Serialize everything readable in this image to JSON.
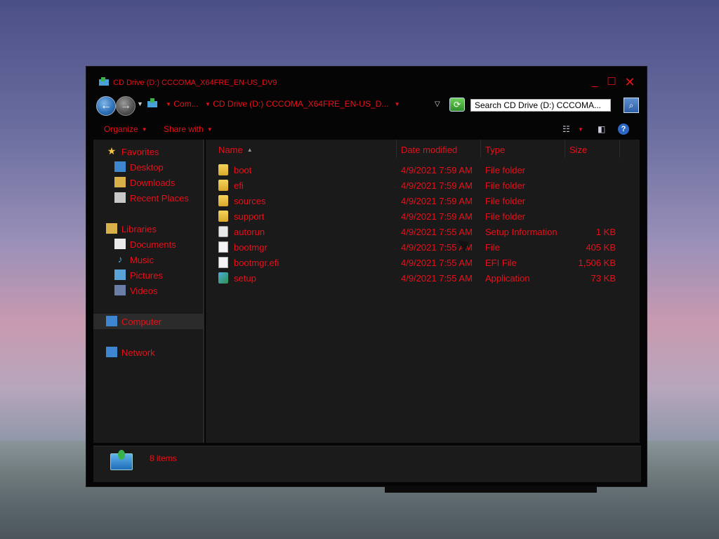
{
  "window": {
    "title": "CD Drive (D:) CCCOMA_X64FRE_EN-US_DV9",
    "controls": {
      "minimize": "_",
      "maximize": "☐",
      "close": "✕"
    }
  },
  "nav": {
    "breadcrumbs": [
      "Com...",
      "CD Drive (D:) CCCOMA_X64FRE_EN-US_D..."
    ],
    "search_placeholder": "Search CD Drive (D:) CCCOMA..."
  },
  "toolbar": {
    "organize": "Organize",
    "share_with": "Share with"
  },
  "sidebar": {
    "favorites": "Favorites",
    "fav_items": [
      "Desktop",
      "Downloads",
      "Recent Places"
    ],
    "libraries": "Libraries",
    "lib_items": [
      "Documents",
      "Music",
      "Pictures",
      "Videos"
    ],
    "computer": "Computer",
    "network": "Network"
  },
  "columns": {
    "name": "Name",
    "date": "Date modified",
    "type": "Type",
    "size": "Size"
  },
  "files": [
    {
      "name": "boot",
      "date": "4/9/2021 7:59 AM",
      "type": "File folder",
      "size": "",
      "icon": "folder-icon"
    },
    {
      "name": "efi",
      "date": "4/9/2021 7:59 AM",
      "type": "File folder",
      "size": "",
      "icon": "folder-icon"
    },
    {
      "name": "sources",
      "date": "4/9/2021 7:59 AM",
      "type": "File folder",
      "size": "",
      "icon": "folder-icon"
    },
    {
      "name": "support",
      "date": "4/9/2021 7:59 AM",
      "type": "File folder",
      "size": "",
      "icon": "folder-icon"
    },
    {
      "name": "autorun",
      "date": "4/9/2021 7:55 AM",
      "type": "Setup Information",
      "size": "1 KB",
      "icon": "setup-info-icon"
    },
    {
      "name": "bootmgr",
      "date": "4/9/2021 7:55 AM",
      "type": "File",
      "size": "405 KB",
      "icon": "file-icon"
    },
    {
      "name": "bootmgr.efi",
      "date": "4/9/2021 7:55 AM",
      "type": "EFI File",
      "size": "1,506 KB",
      "icon": "file-icon"
    },
    {
      "name": "setup",
      "date": "4/9/2021 7:55 AM",
      "type": "Application",
      "size": "73 KB",
      "icon": "application-icon"
    }
  ],
  "status": {
    "items": "8 items"
  },
  "colors": {
    "accent_text": "#e8101a",
    "window_bg": "#050505",
    "pane_bg": "#1a1a1a"
  }
}
